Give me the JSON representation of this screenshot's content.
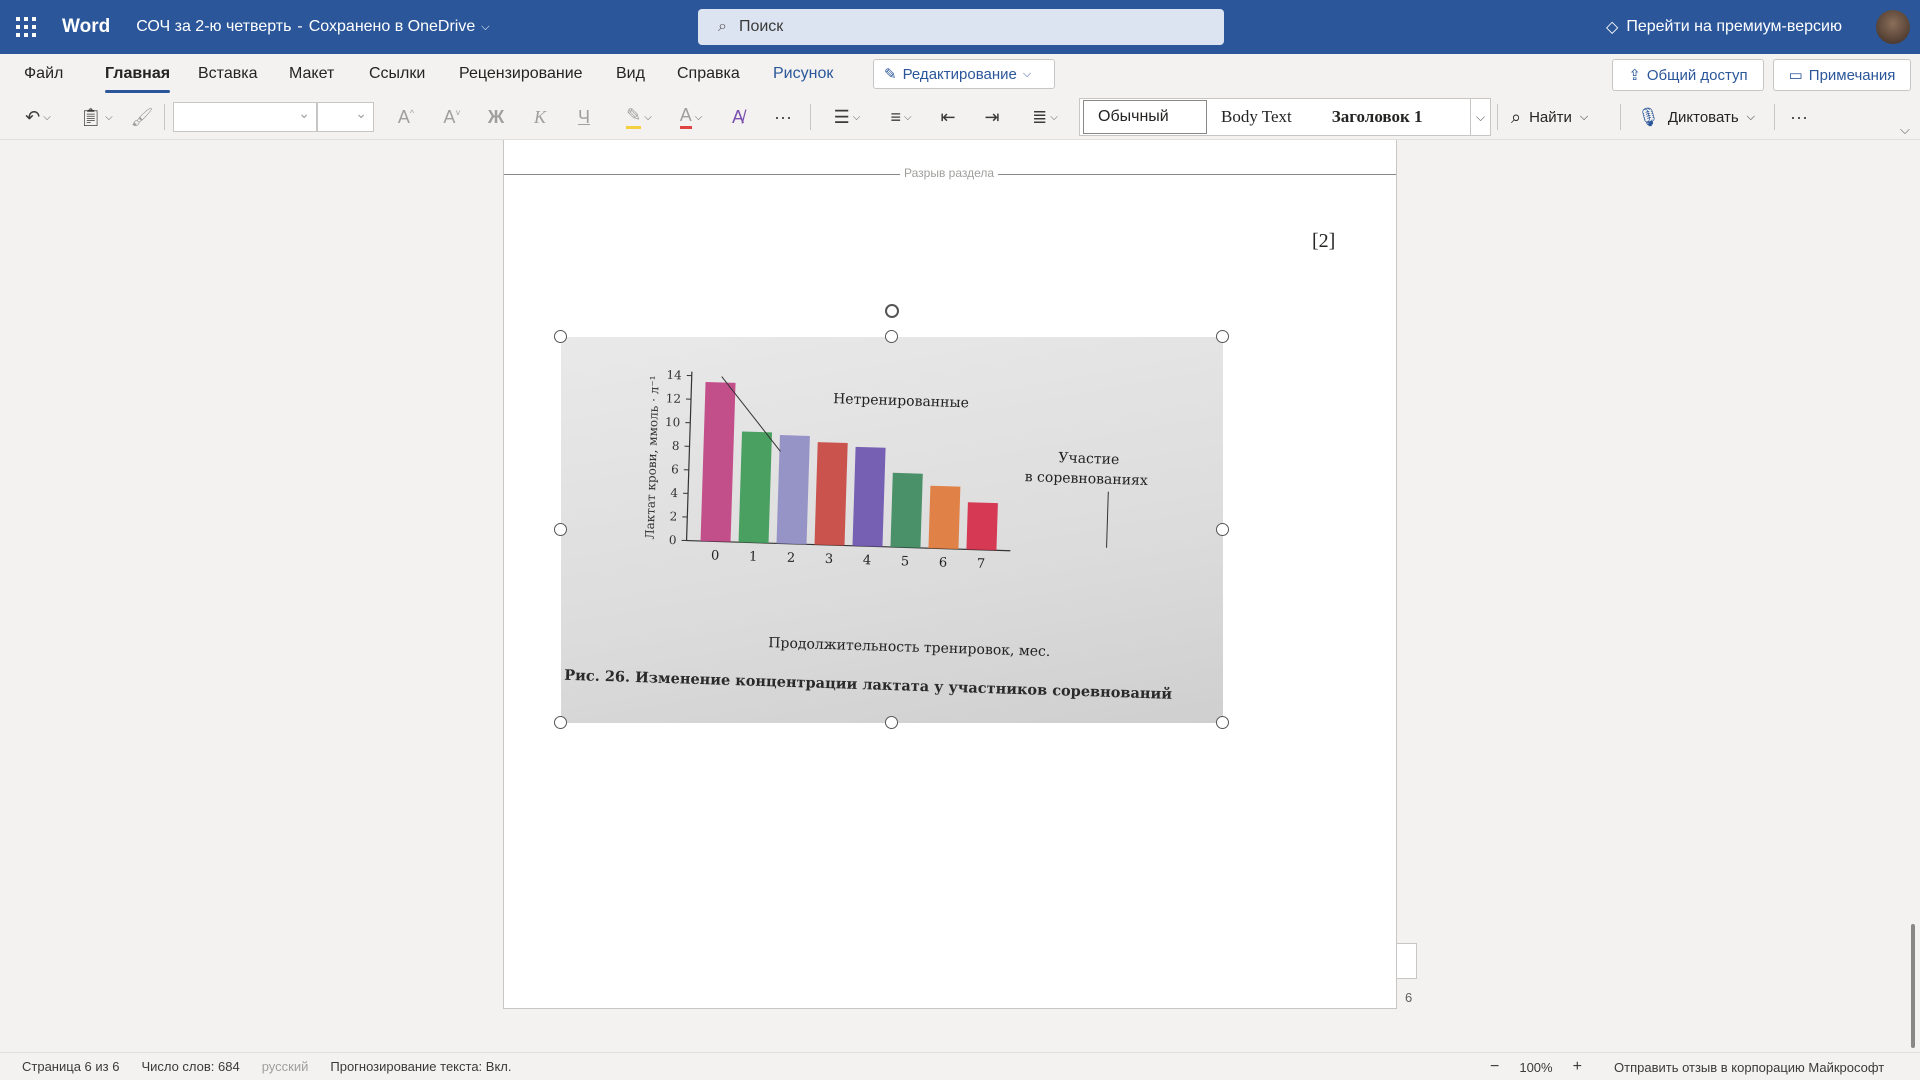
{
  "app": {
    "name": "Word",
    "doc_title": "СОЧ за 2-ю четверть",
    "save_status": "Сохранено в OneDrive",
    "separator": "-"
  },
  "search": {
    "placeholder": "Поиск"
  },
  "premium": {
    "label": "Перейти на премиум-версию"
  },
  "tabs": [
    "Файл",
    "Главная",
    "Вставка",
    "Макет",
    "Ссылки",
    "Рецензирование",
    "Вид",
    "Справка",
    "Рисунок"
  ],
  "active_tab": "Главная",
  "mode": {
    "label": "Редактирование"
  },
  "share": {
    "label": "Общий доступ"
  },
  "comments": {
    "label": "Примечания"
  },
  "toolbar": {
    "bold": "Ж",
    "italic": "К",
    "underline": "Ч",
    "more": "···",
    "styles": [
      "Обычный",
      "Body Text",
      "Заголовок 1"
    ],
    "find": "Найти",
    "dictate": "Диктовать"
  },
  "document": {
    "section_break": "Разрыв раздела",
    "mark": "[2]",
    "page_number": "6"
  },
  "figure": {
    "annotation_untrained": "Нетренированные",
    "annotation_competition_1": "Участие",
    "annotation_competition_2": "в соревнованиях",
    "caption": "Рис. 26. Изменение концентрации лактата у участников соревнований"
  },
  "chart_data": {
    "type": "bar",
    "categories": [
      "0",
      "1",
      "2",
      "3",
      "4",
      "5",
      "6",
      "7"
    ],
    "values": [
      13.5,
      9.4,
      9.2,
      8.7,
      8.4,
      6.3,
      5.3,
      4.0
    ],
    "colors": [
      "#c04282",
      "#3c9a55",
      "#8f8dc4",
      "#c94740",
      "#6d55b0",
      "#3d8a5e",
      "#e07a3a",
      "#d42a47"
    ],
    "xlabel": "Продолжительность тренировок, мес.",
    "ylabel": "Лактат крови, ммоль · л⁻¹",
    "yticks": [
      0,
      2,
      4,
      6,
      8,
      10,
      12,
      14
    ],
    "ylim": [
      0,
      14
    ]
  },
  "status": {
    "page": "Страница 6 из 6",
    "words": "Число слов: 684",
    "language": "русский",
    "prediction": "Прогнозирование текста: Вкл.",
    "zoom": "100%",
    "feedback": "Отправить отзыв в корпорацию Майкрософт"
  }
}
